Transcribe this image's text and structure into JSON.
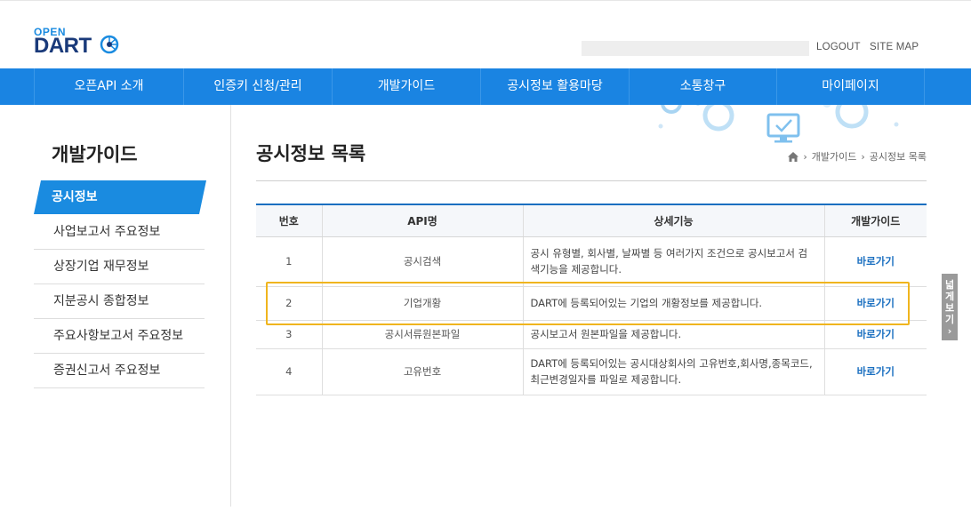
{
  "logo": {
    "open": "OPEN",
    "dart": "DART"
  },
  "util": {
    "logout": "LOGOUT",
    "sitemap": "SITE MAP"
  },
  "gnb": [
    "오픈API 소개",
    "인증키 신청/관리",
    "개발가이드",
    "공시정보 활용마당",
    "소통창구",
    "마이페이지"
  ],
  "lnb": {
    "title": "개발가이드",
    "items": [
      "공시정보",
      "사업보고서 주요정보",
      "상장기업 재무정보",
      "지분공시 종합정보",
      "주요사항보고서 주요정보",
      "증권신고서 주요정보"
    ]
  },
  "content": {
    "title": "공시정보 목록",
    "breadcrumb": [
      "개발가이드",
      "공시정보 목록"
    ]
  },
  "table": {
    "headers": [
      "번호",
      "API명",
      "상세기능",
      "개발가이드"
    ],
    "rows": [
      {
        "no": "1",
        "name": "공시검색",
        "desc": "공시 유형별, 회사별, 날짜별 등 여러가지 조건으로 공시보고서 검색기능을 제공합니다.",
        "link": "바로가기"
      },
      {
        "no": "2",
        "name": "기업개황",
        "desc": "DART에 등록되어있는 기업의 개황정보를 제공합니다.",
        "link": "바로가기"
      },
      {
        "no": "3",
        "name": "공시서류원본파일",
        "desc": "공시보고서 원본파일을 제공합니다.",
        "link": "바로가기"
      },
      {
        "no": "4",
        "name": "고유번호",
        "desc": "DART에 등록되어있는 공시대상회사의 고유번호,회사명,종목코드, 최근변경일자를 파일로 제공합니다.",
        "link": "바로가기"
      }
    ]
  },
  "side_tab": "넓게보기",
  "colors": {
    "brand_blue": "#1a84e2",
    "highlight": "#f0b51e",
    "link": "#1a6fc0"
  }
}
